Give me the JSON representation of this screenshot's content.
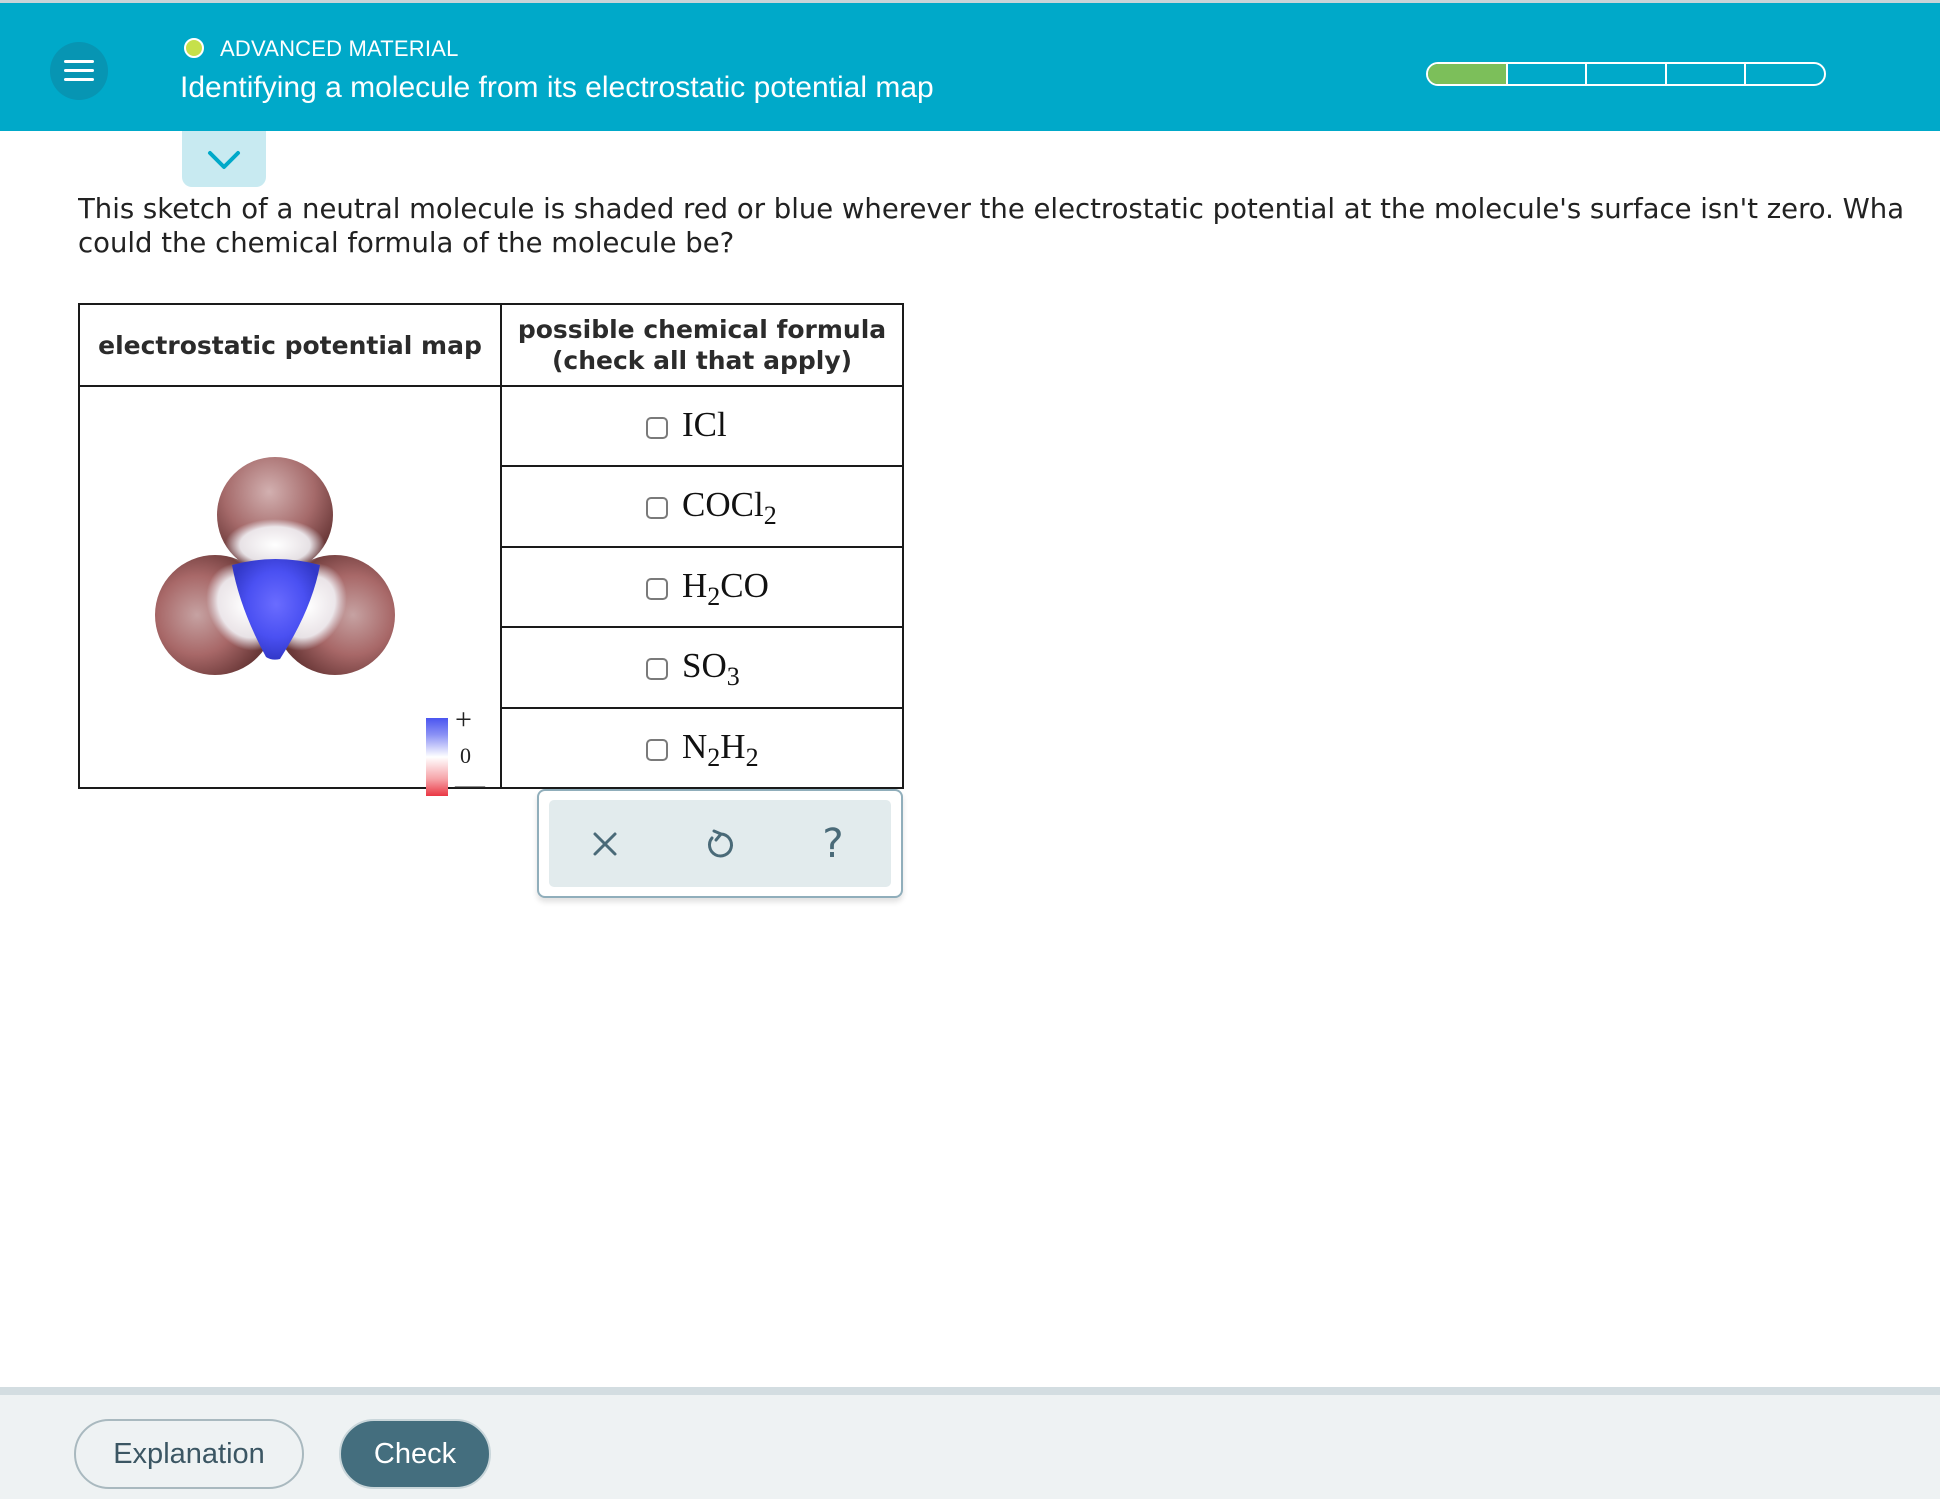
{
  "header": {
    "level_label": "ADVANCED MATERIAL",
    "topic_title": "Identifying a molecule from its electrostatic potential map",
    "progress": {
      "segments": 5,
      "filled": 1
    },
    "level_dot_color": "#c6e04a",
    "background_color": "#00a9c9"
  },
  "question": {
    "line1": "This sketch of a neutral molecule is shaded red or blue wherever the electrostatic potential at the molecule's surface isn't zero. Wha",
    "line2": "could the chemical formula of the molecule be?"
  },
  "table": {
    "col_map_header": "electrostatic potential map",
    "col_formula_header": "possible chemical formula",
    "col_formula_subheader": "(check all that apply)",
    "legend": {
      "plus": "+",
      "zero": "0",
      "minus": "—"
    },
    "options": [
      {
        "main": "ICl",
        "sub": "",
        "tail": "",
        "checked": false
      },
      {
        "main": "COCl",
        "sub": "2",
        "tail": "",
        "checked": false
      },
      {
        "main": "H",
        "sub": "2",
        "tail": "CO",
        "checked": false
      },
      {
        "main": "SO",
        "sub": "3",
        "tail": "",
        "checked": false
      },
      {
        "main": "N",
        "sub": "2",
        "tail": "H",
        "sub2": "2",
        "checked": false
      }
    ]
  },
  "toolbox": {
    "icons": [
      "close-icon",
      "undo-icon",
      "help-icon"
    ],
    "help_label": "?"
  },
  "footer": {
    "explanation_label": "Explanation",
    "check_label": "Check",
    "check_color": "#446e7e"
  }
}
